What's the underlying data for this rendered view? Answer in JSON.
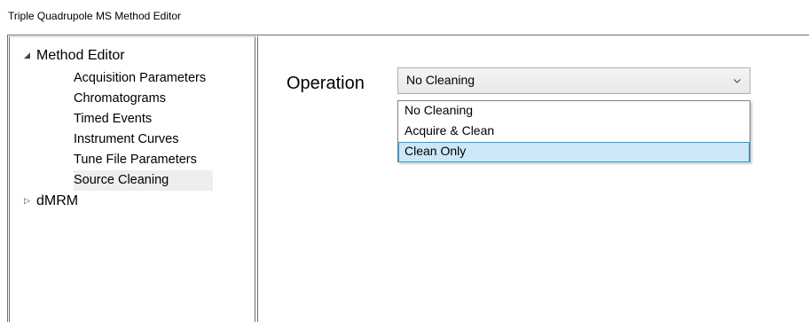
{
  "window": {
    "title": "Triple Quadrupole MS Method Editor"
  },
  "tree": {
    "root_label": "Method Editor",
    "children": [
      "Acquisition Parameters",
      "Chromatograms",
      "Timed Events",
      "Instrument Curves",
      "Tune File Parameters",
      "Source Cleaning"
    ],
    "selected": "Source Cleaning",
    "second_root_label": "dMRM"
  },
  "operation": {
    "label": "Operation",
    "selected_value": "No Cleaning",
    "options": [
      "No Cleaning",
      "Acquire & Clean",
      "Clean Only"
    ],
    "highlighted_option": "Clean Only"
  },
  "colors": {
    "highlight_fill": "#cce8f7",
    "highlight_border": "#26a0da",
    "selected_tree_item": "#eeeeee"
  }
}
